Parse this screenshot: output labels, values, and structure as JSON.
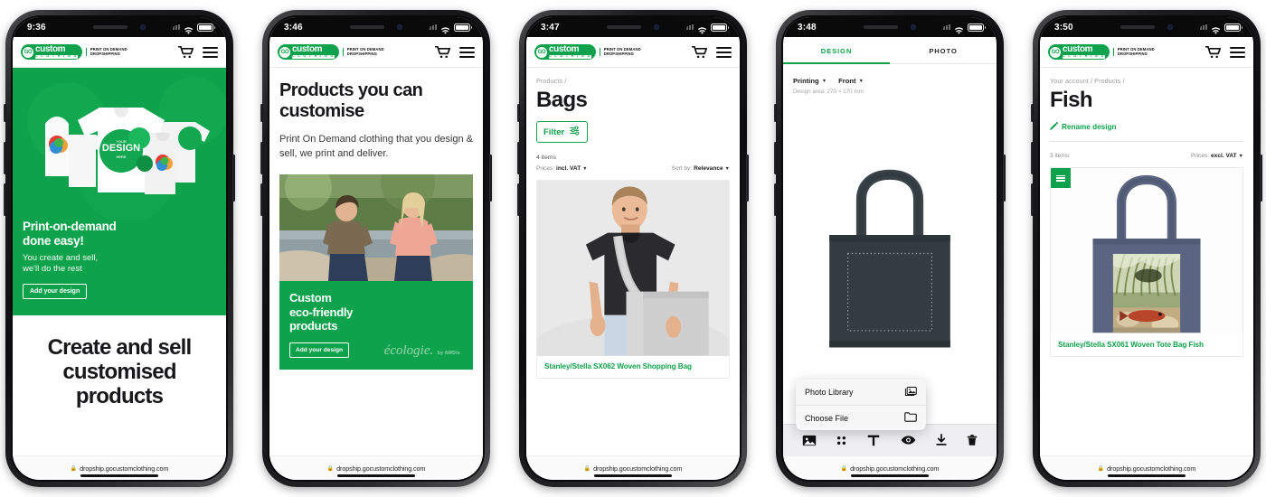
{
  "brand": {
    "accent": "#0fa24c",
    "logo_go": "GO",
    "logo_custom": "custom",
    "logo_clothing": "C L O T H I N G",
    "tagline_1": "PRINT ON DEMAND",
    "tagline_2": "DROPSHIPPING"
  },
  "url": "dropship.gocustomclothing.com",
  "lock": "🔒",
  "phones": [
    {
      "time": "9:36",
      "hero": {
        "heading": "Print-on-demand\ndone easy!",
        "subtext": "You create and sell,\nwe'll do the rest",
        "cta": "Add your design",
        "art_label": "YOUR DESIGN HERE"
      },
      "big_text": "Create and sell customised products"
    },
    {
      "time": "3:46",
      "title": "Products you can customise",
      "lead": "Print On Demand clothing that you design & sell, we print and deliver.",
      "banner": {
        "heading": "Custom\neco-friendly\nproducts",
        "cta": "Add your design",
        "logo_main": "écologie.",
        "logo_sub": "by AWDis"
      }
    },
    {
      "time": "3:47",
      "breadcrumb": "Products /",
      "title": "Bags",
      "filter_label": "Filter",
      "item_count": "4 items",
      "prices_label": "Prices:",
      "prices_value": "incl. VAT",
      "sort_label": "Sort by:",
      "sort_value": "Relevance",
      "product_name": "Stanley/Stella SX062 Woven Shopping Bag"
    },
    {
      "time": "3:48",
      "tabs": [
        {
          "label": "DESIGN",
          "active": true
        },
        {
          "label": "PHOTO",
          "active": false
        }
      ],
      "opt_print": "Printing",
      "opt_side": "Front",
      "design_area": "Design area: 270 × 270 mm",
      "tools": [
        "image-icon",
        "clipart-icon",
        "text-icon",
        "preview-eye-icon",
        "download-icon",
        "delete-trash-icon"
      ],
      "menu": [
        {
          "label": "Photo Library",
          "icon": "photo-library-icon"
        },
        {
          "label": "Choose File",
          "icon": "folder-icon"
        }
      ]
    },
    {
      "time": "3:50",
      "breadcrumb": "Your account / Products /",
      "title": "Fish",
      "rename": "Rename design",
      "item_count": "3 items",
      "prices_label": "Prices:",
      "prices_value": "excl. VAT",
      "product_name": "Stanley/Stella SX061 Woven Tote Bag Fish"
    }
  ]
}
